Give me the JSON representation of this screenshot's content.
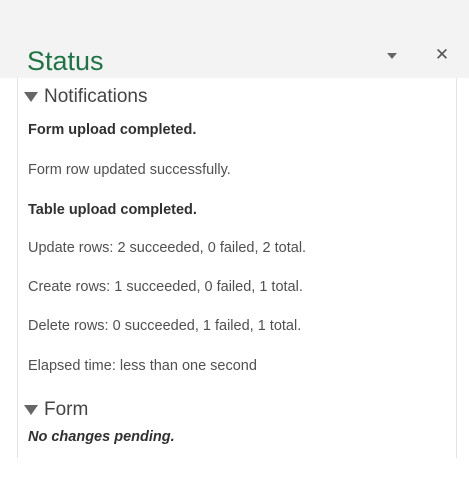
{
  "pane": {
    "title": "Status",
    "accent_color": "#217346",
    "dropdown_icon": "caret-down-icon",
    "close_icon": "close-icon",
    "close_glyph": "✕"
  },
  "notifications": {
    "heading": "Notifications",
    "lines": [
      {
        "text": "Form upload completed.",
        "style": "bold"
      },
      {
        "text": "Form row updated successfully.",
        "style": "normal"
      },
      {
        "text": "Table upload completed.",
        "style": "bold"
      },
      {
        "text": "Update rows:  2 succeeded, 0 failed, 2 total.",
        "style": "normal"
      },
      {
        "text": "Create rows: 1 succeeded, 0 failed, 1 total.",
        "style": "normal"
      },
      {
        "text": "Delete rows: 0 succeeded, 1 failed, 1 total.",
        "style": "normal"
      },
      {
        "text": "Elapsed time: less than one second",
        "style": "normal"
      }
    ]
  },
  "form": {
    "heading": "Form",
    "message": "No changes pending."
  }
}
